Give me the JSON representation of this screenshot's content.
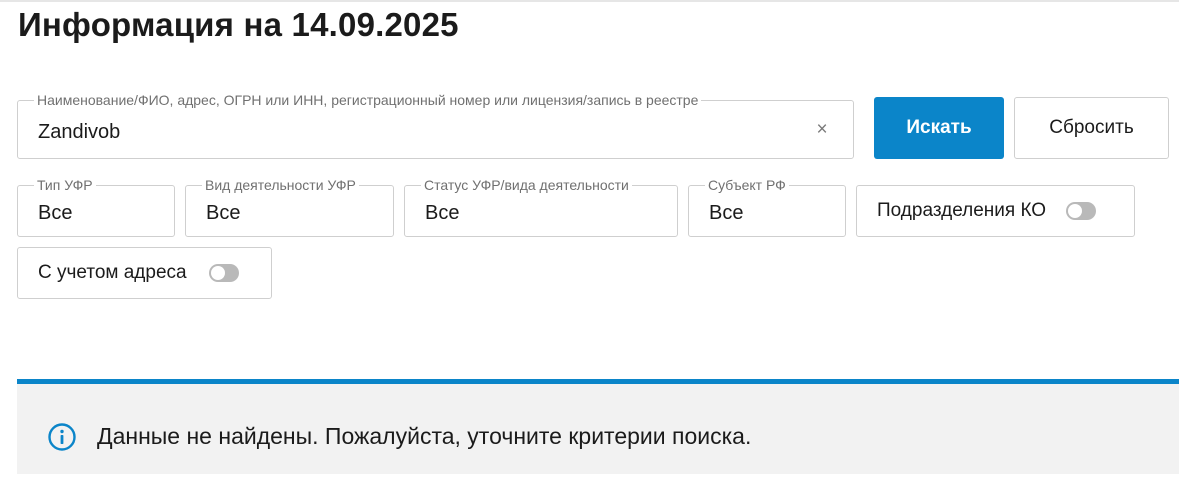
{
  "page": {
    "title": "Информация на 14.09.2025"
  },
  "search": {
    "label": "Наименование/ФИО, адрес, ОГРН или ИНН, регистрационный номер или лицензия/запись в реестре",
    "value": "Zandivob",
    "clear_glyph": "×",
    "search_button": "Искать",
    "reset_button": "Сбросить"
  },
  "filters": [
    {
      "label": "Тип УФР",
      "value": "Все"
    },
    {
      "label": "Вид деятельности УФР",
      "value": "Все"
    },
    {
      "label": "Статус УФР/вида деятельности",
      "value": "Все"
    },
    {
      "label": "Субъект РФ",
      "value": "Все"
    }
  ],
  "toggles": {
    "ko_divisions": {
      "label": "Подразделения КО",
      "on": false
    },
    "with_address": {
      "label": "С учетом адреса",
      "on": false
    }
  },
  "notice": {
    "icon": "info-icon",
    "text": "Данные не найдены. Пожалуйста, уточните критерии поиска."
  },
  "colors": {
    "accent": "#0b85c9",
    "border": "#cfcfcf",
    "notice_bg": "#f2f2f2",
    "label": "#707070"
  }
}
